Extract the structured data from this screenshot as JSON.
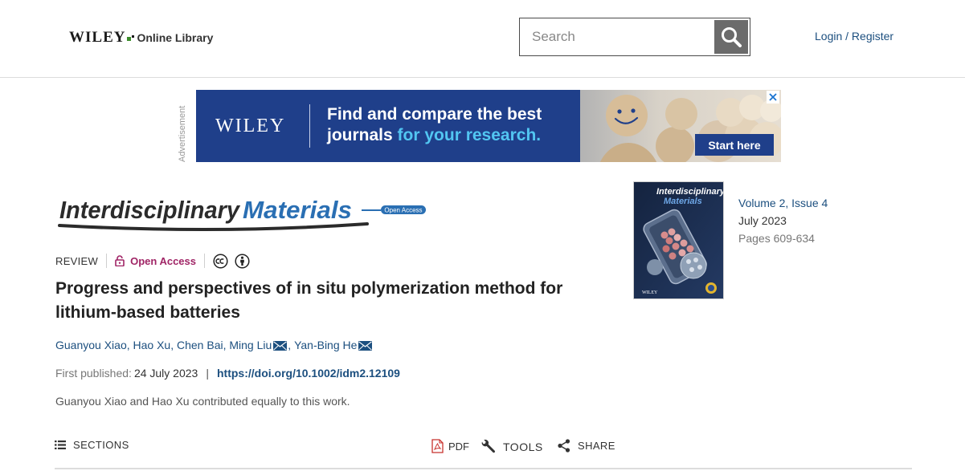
{
  "header": {
    "brand_name": "WILEY",
    "brand_sub": "Online Library",
    "search_placeholder": "Search",
    "login_label": "Login / Register"
  },
  "ad": {
    "side_label": "Advertisement",
    "brand": "WILEY",
    "headline_part1": "Find and compare the best",
    "headline_part2": "journals",
    "headline_highlight": "for your research.",
    "cta": "Start here"
  },
  "journal": {
    "name_word1": "Interdisciplinary",
    "name_word2": "Materials",
    "badge": "Open Access"
  },
  "article": {
    "type": "REVIEW",
    "open_access_label": "Open Access",
    "title": "Progress and perspectives of in situ polymerization method for lithium-based batteries",
    "authors": [
      {
        "name": "Guanyou Xiao",
        "corresponding": false
      },
      {
        "name": "Hao Xu",
        "corresponding": false
      },
      {
        "name": "Chen Bai",
        "corresponding": false
      },
      {
        "name": "Ming Liu",
        "corresponding": true
      },
      {
        "name": "Yan-Bing He",
        "corresponding": true
      }
    ],
    "first_published_label": "First published:",
    "first_published_date": "24 July 2023",
    "doi": "https://doi.org/10.1002/idm2.12109",
    "note": "Guanyou Xiao and Hao Xu contributed equally to this work."
  },
  "issue": {
    "cover_title_line1": "Interdisciplinary",
    "cover_title_line2": "Materials",
    "cover_brand": "WILEY",
    "volume": "Volume 2, Issue 4",
    "date": "July 2023",
    "pages": "Pages 609-634"
  },
  "toolbar": {
    "sections": "SECTIONS",
    "pdf": "PDF",
    "tools": "TOOLS",
    "share": "SHARE"
  },
  "colors": {
    "link": "#1c4f7f",
    "open_access": "#a02566",
    "ad_background": "#1f3f8a",
    "ad_highlight": "#52c6f2",
    "journal_blue": "#2a6fb3"
  }
}
